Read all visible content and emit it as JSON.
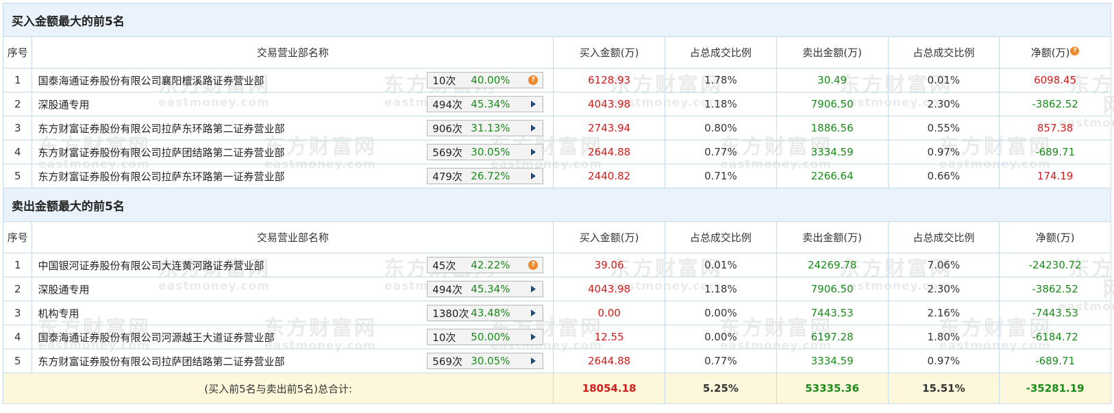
{
  "sections": [
    {
      "title": "买入金额最大的前5名",
      "rows": [
        {
          "rank": "1",
          "name": "国泰海通证券股份有限公司襄阳檀溪路证券营业部",
          "count": "10次",
          "pct": "40.00%",
          "icon": "question-icon",
          "buy": "6128.93",
          "buy_ratio": "1.78%",
          "sell": "30.49",
          "sell_ratio": "0.01%",
          "net": "6098.45"
        },
        {
          "rank": "2",
          "name": "深股通专用",
          "count": "494次",
          "pct": "45.34%",
          "icon": "arrow-right-icon",
          "buy": "4043.98",
          "buy_ratio": "1.18%",
          "sell": "7906.50",
          "sell_ratio": "2.30%",
          "net": "-3862.52"
        },
        {
          "rank": "3",
          "name": "东方财富证券股份有限公司拉萨东环路第二证券营业部",
          "count": "906次",
          "pct": "31.13%",
          "icon": "arrow-right-icon",
          "buy": "2743.94",
          "buy_ratio": "0.80%",
          "sell": "1886.56",
          "sell_ratio": "0.55%",
          "net": "857.38"
        },
        {
          "rank": "4",
          "name": "东方财富证券股份有限公司拉萨团结路第二证券营业部",
          "count": "569次",
          "pct": "30.05%",
          "icon": "arrow-right-icon",
          "buy": "2644.88",
          "buy_ratio": "0.77%",
          "sell": "3334.59",
          "sell_ratio": "0.97%",
          "net": "-689.71"
        },
        {
          "rank": "5",
          "name": "东方财富证券股份有限公司拉萨东环路第一证券营业部",
          "count": "479次",
          "pct": "26.72%",
          "icon": "arrow-right-icon",
          "buy": "2440.82",
          "buy_ratio": "0.71%",
          "sell": "2266.64",
          "sell_ratio": "0.66%",
          "net": "174.19"
        }
      ]
    },
    {
      "title": "卖出金额最大的前5名",
      "rows": [
        {
          "rank": "1",
          "name": "中国银河证券股份有限公司大连黄河路证券营业部",
          "count": "45次",
          "pct": "42.22%",
          "icon": "question-icon",
          "buy": "39.06",
          "buy_ratio": "0.01%",
          "sell": "24269.78",
          "sell_ratio": "7.06%",
          "net": "-24230.72"
        },
        {
          "rank": "2",
          "name": "深股通专用",
          "count": "494次",
          "pct": "45.34%",
          "icon": "arrow-right-icon",
          "buy": "4043.98",
          "buy_ratio": "1.18%",
          "sell": "7906.50",
          "sell_ratio": "2.30%",
          "net": "-3862.52"
        },
        {
          "rank": "3",
          "name": "机构专用",
          "count": "1380次",
          "pct": "43.48%",
          "icon": "arrow-right-icon",
          "buy": "0.00",
          "buy_ratio": "0.00%",
          "sell": "7443.53",
          "sell_ratio": "2.16%",
          "net": "-7443.53"
        },
        {
          "rank": "4",
          "name": "国泰海通证券股份有限公司河源越王大道证券营业部",
          "count": "10次",
          "pct": "50.00%",
          "icon": "arrow-right-icon",
          "buy": "12.55",
          "buy_ratio": "0.00%",
          "sell": "6197.28",
          "sell_ratio": "1.80%",
          "net": "-6184.72"
        },
        {
          "rank": "5",
          "name": "东方财富证券股份有限公司拉萨团结路第二证券营业部",
          "count": "569次",
          "pct": "30.05%",
          "icon": "arrow-right-icon",
          "buy": "2644.88",
          "buy_ratio": "0.77%",
          "sell": "3334.59",
          "sell_ratio": "0.97%",
          "net": "-689.71"
        }
      ]
    }
  ],
  "headers": {
    "rank": "序号",
    "name": "交易营业部名称",
    "buy": "买入金额(万)",
    "buy_ratio": "占总成交比例",
    "sell": "卖出金额(万)",
    "sell_ratio": "占总成交比例",
    "net": "净额(万)"
  },
  "total": {
    "label": "(买入前5名与卖出前5名)总合计:",
    "buy": "18054.18",
    "buy_ratio": "5.25%",
    "sell": "53335.36",
    "sell_ratio": "15.51%",
    "net": "-35281.19"
  },
  "watermark": {
    "cn": "东方财富网",
    "en": "eastmoney.com"
  },
  "colors": {
    "positive": "#d11a1a",
    "negative": "#1a8a1a",
    "section_bg": "#eaf3fb",
    "total_bg": "#fdf8dc",
    "border": "#c6dbe9",
    "icon_orange": "#f0882e"
  }
}
